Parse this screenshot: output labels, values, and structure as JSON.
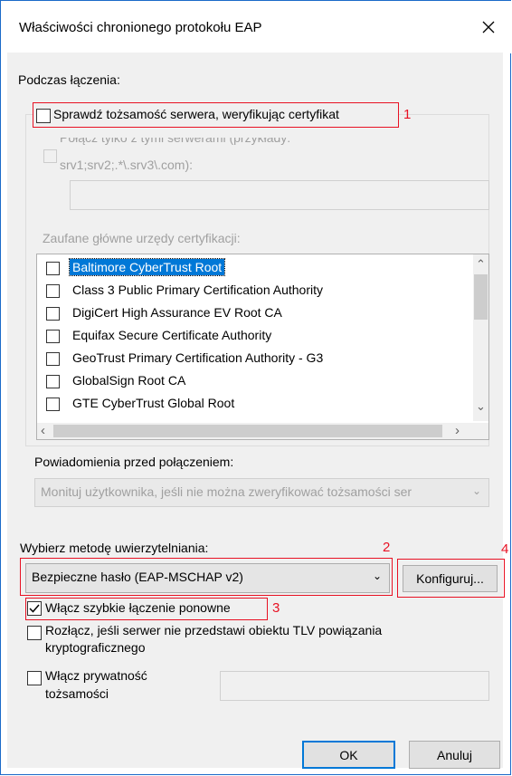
{
  "dialog": {
    "title": "Właściwości chronionego protokołu EAP"
  },
  "section_connect": {
    "heading": "Podczas łączenia:",
    "verify_server_label": "Sprawdź tożsamość serwera, weryfikując certyfikat",
    "connect_servers_label_line1": "Połącz tylko z tymi serwerami (przykłady:",
    "connect_servers_label_line2": "srv1;srv2;.*\\.srv3\\.com):",
    "servers_value": "",
    "trusted_ca_label": "Zaufane główne urzędy certyfikacji:",
    "trusted_ca_list": [
      {
        "label": "Baltimore CyberTrust Root",
        "checked": false,
        "selected": true
      },
      {
        "label": "Class 3 Public Primary Certification Authority",
        "checked": false,
        "selected": false
      },
      {
        "label": "DigiCert High Assurance EV Root CA",
        "checked": false,
        "selected": false
      },
      {
        "label": "Equifax Secure Certificate Authority",
        "checked": false,
        "selected": false
      },
      {
        "label": "GeoTrust Primary Certification Authority - G3",
        "checked": false,
        "selected": false
      },
      {
        "label": "GlobalSign Root CA",
        "checked": false,
        "selected": false
      },
      {
        "label": "GTE CyberTrust Global Root",
        "checked": false,
        "selected": false
      }
    ],
    "notifications_label": "Powiadomienia przed połączeniem:",
    "notifications_value": "Monituj użytkownika, jeśli nie można zweryfikować tożsamości ser"
  },
  "auth": {
    "method_label": "Wybierz metodę uwierzytelniania:",
    "method_value": "Bezpieczne hasło (EAP-MSCHAP v2)",
    "configure_label": "Konfiguruj...",
    "fast_reconnect_label": "Włącz szybkie łączenie ponowne",
    "fast_reconnect_checked": true,
    "disconnect_line1": "Rozłącz, jeśli serwer nie przedstawi obiektu TLV powiązania",
    "disconnect_line2": "kryptograficznego",
    "privacy_line1": "Włącz prywatność",
    "privacy_line2": "tożsamości",
    "privacy_value": ""
  },
  "annotations": [
    "1",
    "2",
    "3",
    "4"
  ],
  "buttons": {
    "ok": "OK",
    "cancel": "Anuluj"
  },
  "colors": {
    "annotation_red": "#e81123",
    "selection_blue": "#0078d7",
    "dialog_bg": "#f0f0f0"
  }
}
